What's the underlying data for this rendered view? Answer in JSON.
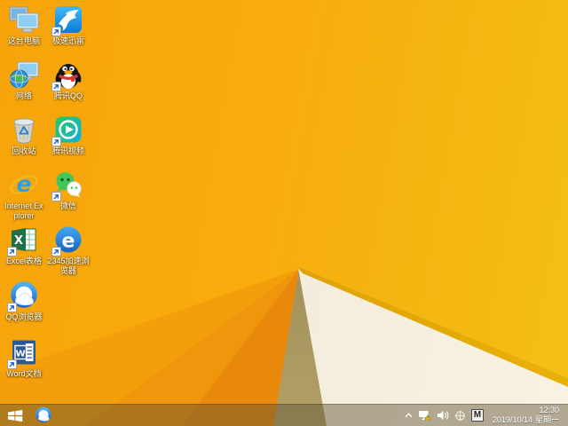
{
  "wallpaper": {
    "base_left": "#F6A40A",
    "base_right": "#F3C015",
    "facet_mid": "#EF960C",
    "facet_deep": "#E8890B",
    "fold_shadow_top": "#6E5E33",
    "fold_shadow_bottom": "#B2A067",
    "fold_white": "#F4EDDD",
    "fold_edge": "#D89E04"
  },
  "desktop": {
    "icons": [
      {
        "label": "这台电脑",
        "type": "this-pc",
        "shortcut": false
      },
      {
        "label": "极速迅雷",
        "type": "thunder",
        "shortcut": true
      },
      {
        "label": "网络",
        "type": "network",
        "shortcut": false
      },
      {
        "label": "腾讯QQ",
        "type": "tencent-qq",
        "shortcut": true
      },
      {
        "label": "回收站",
        "type": "recycle-bin",
        "shortcut": false
      },
      {
        "label": "腾讯视频",
        "type": "tencent-video",
        "shortcut": true
      },
      {
        "label": "Internet Explorer",
        "type": "internet-explorer",
        "shortcut": false
      },
      {
        "label": "微信",
        "type": "wechat",
        "shortcut": true
      },
      {
        "label": "Excel表格",
        "type": "excel",
        "shortcut": true
      },
      {
        "label": "2345加速浏览器",
        "type": "2345-browser",
        "shortcut": true
      },
      {
        "label": "QQ浏览器",
        "type": "qq-browser",
        "shortcut": true
      },
      {
        "label": "Word文档",
        "type": "word",
        "shortcut": true
      }
    ]
  },
  "taskbar": {
    "pinned": [
      {
        "name": "qq-browser"
      }
    ],
    "tray_icons": [
      "show-hidden",
      "network-warning",
      "volume",
      "scope",
      "input-method"
    ],
    "input_indicator": "M",
    "clock": {
      "time": "12:30",
      "date": "2019/10/14",
      "weekday": "星期一"
    }
  }
}
